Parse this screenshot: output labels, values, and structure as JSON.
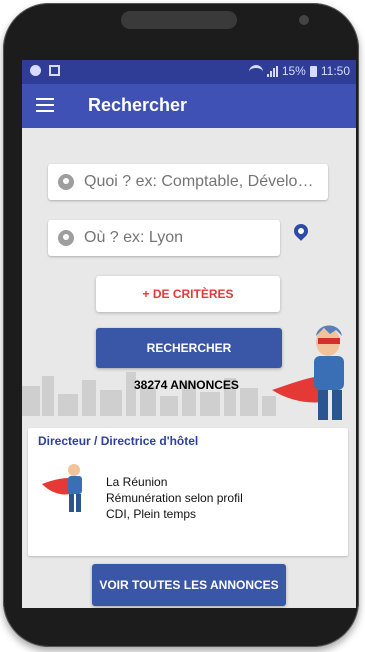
{
  "statusbar": {
    "battery": "15%",
    "time": "11:50"
  },
  "appbar": {
    "title": "Rechercher"
  },
  "search": {
    "what_placeholder": "Quoi ? ex: Comptable, Dévelo…",
    "where_placeholder": "Où ? ex: Lyon"
  },
  "buttons": {
    "criteria": "+ DE CRITÈRES",
    "search": "RECHERCHER",
    "all": "VOIR TOUTES LES ANNONCES"
  },
  "results": {
    "count": "38274 ANNONCES"
  },
  "job": {
    "title": "Directeur / Directrice d'hôtel",
    "location": "La Réunion",
    "salary": "Rémunération selon profil",
    "contract": "CDI, Plein temps"
  },
  "colors": {
    "appbar": "#3f51b5",
    "statusbar": "#2f3d96",
    "primary_button": "#3a56a7",
    "criteria_text": "#e53935",
    "job_title": "#2e3f9e"
  },
  "icons": {
    "menu": "menu-icon",
    "what": "person-icon",
    "where": "location-icon",
    "geolocate": "pin-icon"
  }
}
